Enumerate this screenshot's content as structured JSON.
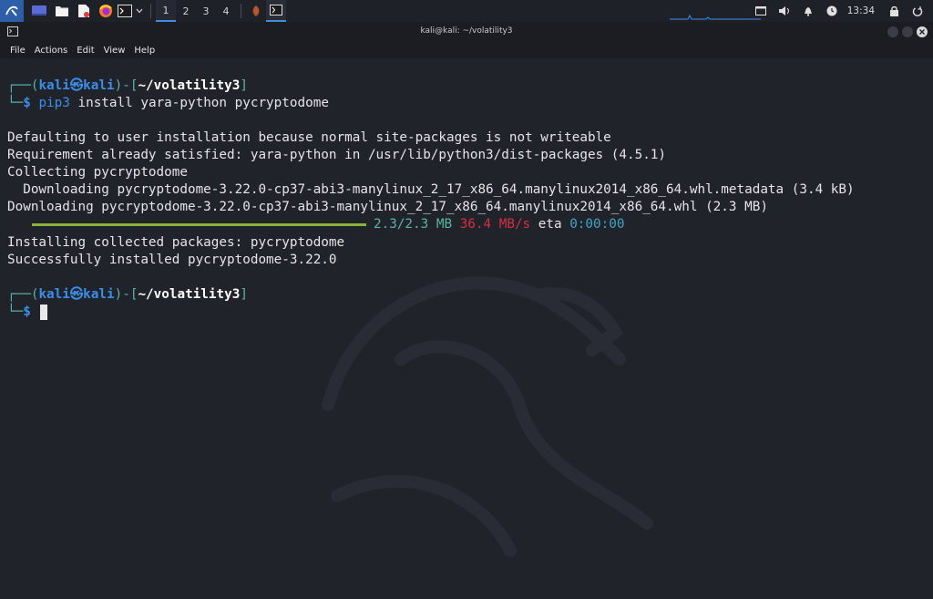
{
  "panel": {
    "workspaces": [
      "1",
      "2",
      "3",
      "4"
    ],
    "clock": "13:34",
    "launchers": [
      "kali-menu-icon",
      "desktop-icon",
      "files-icon",
      "text-editor-icon",
      "firefox-icon",
      "terminal-icon"
    ]
  },
  "window": {
    "title": "kali@kali: ~/volatility3",
    "menu": [
      "File",
      "Actions",
      "Edit",
      "View",
      "Help"
    ]
  },
  "terminal": {
    "prompt1": {
      "open": "┌──(",
      "user": "kali",
      "at": "㉿",
      "host": "kali",
      "mid": ")-[",
      "dir": "~/volatility3",
      "close": "]",
      "corner": "└─",
      "dollar": "$",
      "command_bin": "pip3",
      "command_args": " install yara-python pycryptodome"
    },
    "lines": [
      "Defaulting to user installation because normal site-packages is not writeable",
      "Requirement already satisfied: yara-python in /usr/lib/python3/dist-packages (4.5.1)",
      "Collecting pycryptodome",
      "  Downloading pycryptodome-3.22.0-cp37-abi3-manylinux_2_17_x86_64.manylinux2014_x86_64.whl.metadata (3.4 kB)",
      "Downloading pycryptodome-3.22.0-cp37-abi3-manylinux_2_17_x86_64.manylinux2014_x86_64.whl (2.3 MB)"
    ],
    "progress": {
      "fraction": 1.0,
      "size": "2.3/2.3 MB",
      "speed": "36.4 MB/s",
      "eta_label": "eta",
      "eta": "0:00:00"
    },
    "lines2": [
      "Installing collected packages: pycryptodome",
      "Successfully installed pycryptodome-3.22.0"
    ],
    "prompt2": {
      "open": "┌──(",
      "user": "kali",
      "at": "㉿",
      "host": "kali",
      "mid": ")-[",
      "dir": "~/volatility3",
      "close": "]",
      "corner": "└─",
      "dollar": "$"
    }
  },
  "colors": {
    "terminal_bg": "#21232b",
    "prompt_blue": "#3b8ee8",
    "progress_green": "#8bb23a",
    "speed_red": "#d2313f",
    "eta_cyan": "#3fa7c4"
  }
}
